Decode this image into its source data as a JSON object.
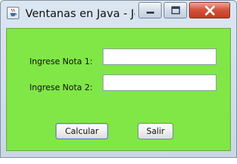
{
  "window": {
    "title": "Ventanas en Java - Jc...",
    "controls": {
      "minimize": "minimize",
      "maximize": "maximize",
      "close": "close"
    }
  },
  "form": {
    "nota1_label": "Ingrese Nota 1:",
    "nota1_value": "",
    "nota2_label": "Ingrese Nota 2:",
    "nota2_value": ""
  },
  "buttons": {
    "calcular": "Calcular",
    "salir": "Salir"
  },
  "colors": {
    "content_background": "#80e746",
    "close_button": "#c23a22"
  },
  "icons": {
    "app": "java-coffee-cup-icon",
    "minimize": "minimize-icon",
    "maximize": "maximize-icon",
    "close": "close-icon"
  }
}
